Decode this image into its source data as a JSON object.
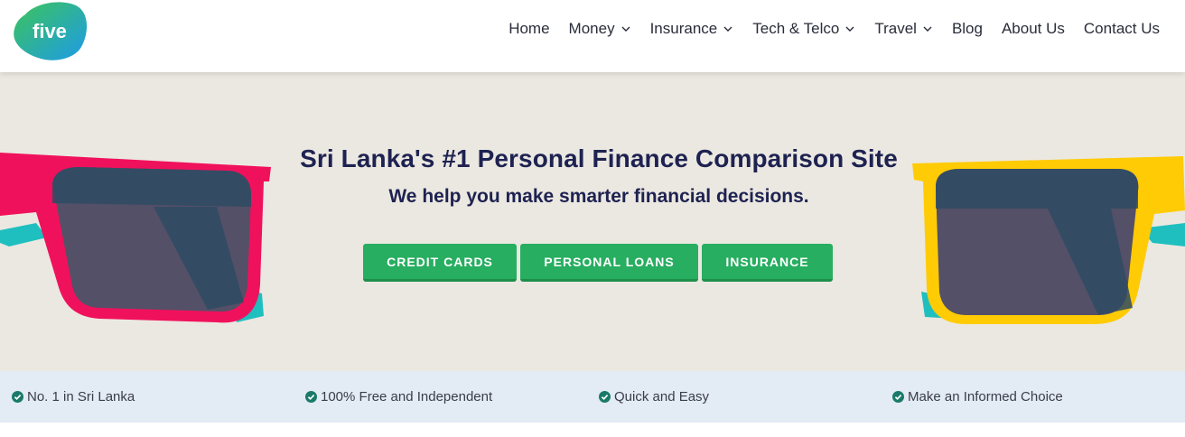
{
  "brand": {
    "logo_text": "five",
    "colors": {
      "logo_green": "#3cc45a",
      "logo_blue": "#1e9be8",
      "accent_green": "#27ae60",
      "navy": "#1e2251"
    }
  },
  "nav": {
    "items": [
      {
        "label": "Home",
        "has_dropdown": false
      },
      {
        "label": "Money",
        "has_dropdown": true
      },
      {
        "label": "Insurance",
        "has_dropdown": true
      },
      {
        "label": "Tech & Telco",
        "has_dropdown": true
      },
      {
        "label": "Travel",
        "has_dropdown": true
      },
      {
        "label": "Blog",
        "has_dropdown": false
      },
      {
        "label": "About Us",
        "has_dropdown": false
      },
      {
        "label": "Contact Us",
        "has_dropdown": false
      }
    ],
    "dropdown_icon": "chevron-down-icon"
  },
  "hero": {
    "title": "Sri Lanka's #1 Personal Finance Comparison Site",
    "subtitle": "We help you make smarter financial decisions.",
    "buttons": [
      "CREDIT CARDS",
      "PERSONAL LOANS",
      "INSURANCE"
    ],
    "illustration": {
      "left": "pink-sunglasses",
      "right": "yellow-sunglasses"
    }
  },
  "features": {
    "icon": "check-circle-icon",
    "items": [
      "No. 1 in Sri Lanka",
      "100% Free and Independent",
      "Quick and Easy",
      "Make an Informed Choice"
    ]
  }
}
